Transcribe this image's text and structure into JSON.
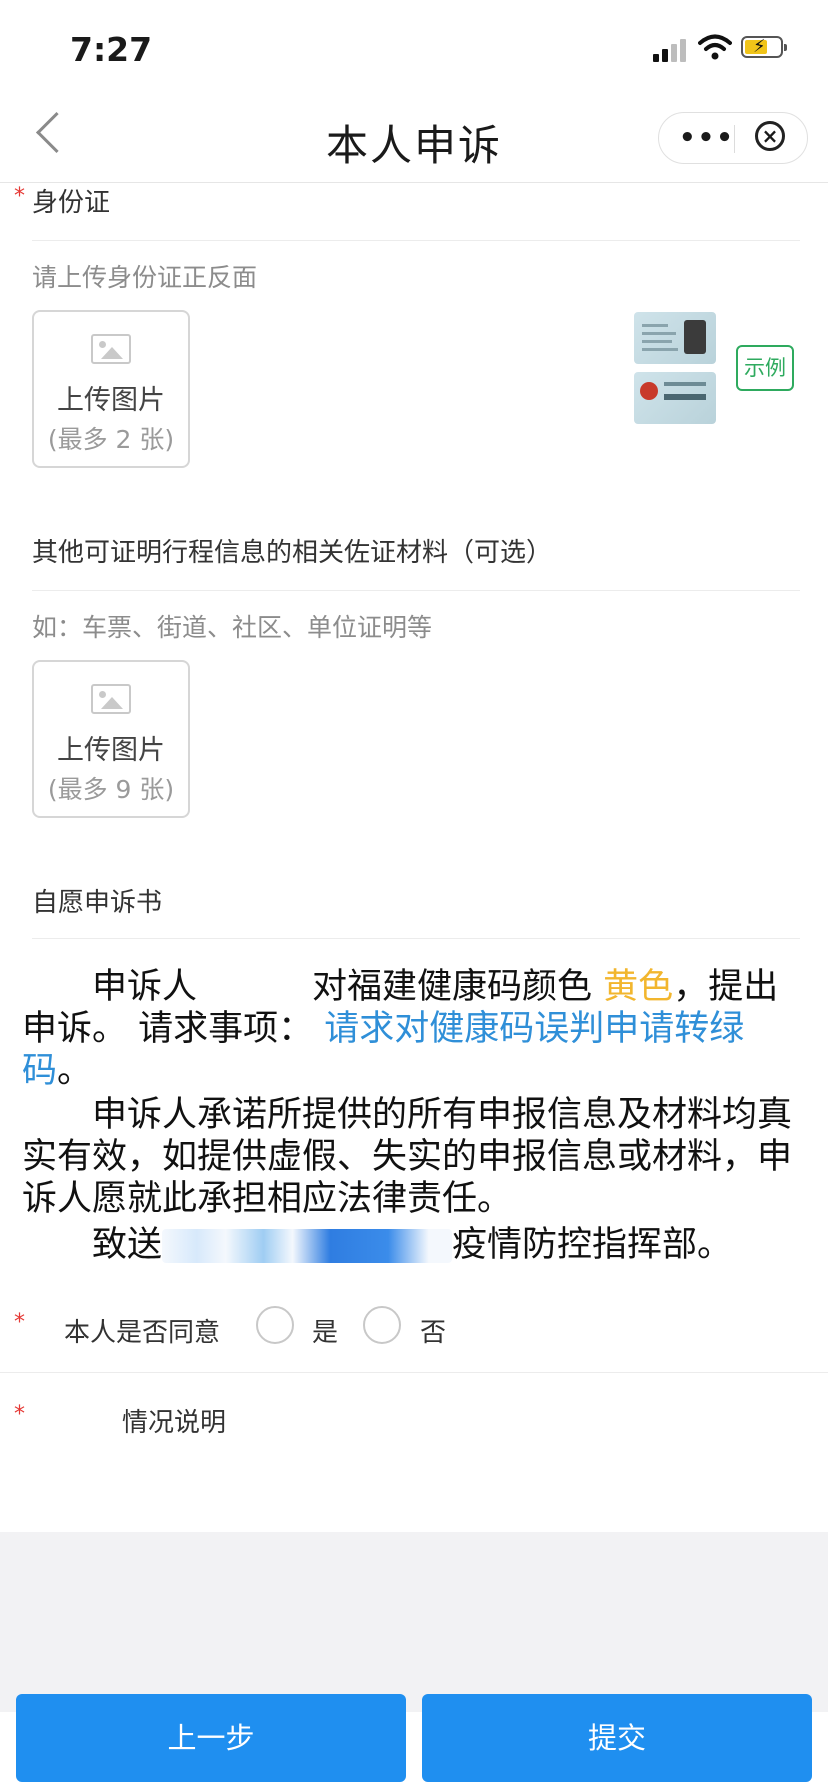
{
  "status_bar": {
    "time": "7:27"
  },
  "nav": {
    "title": "本人申诉",
    "more_icon": "more-dots-icon",
    "close_icon": "close-circle-icon"
  },
  "id_section": {
    "required_mark": "*",
    "label": "身份证",
    "hint": "请上传身份证正反面",
    "upload": {
      "label": "上传图片",
      "limit": "(最多 2 张)"
    },
    "example_label": "示例"
  },
  "evidence_section": {
    "label": "其他可证明行程信息的相关佐证材料（可选）",
    "hint": "如：车票、街道、社区、单位证明等",
    "upload": {
      "label": "上传图片",
      "limit": "(最多 9 张)"
    }
  },
  "statement_section": {
    "label": "自愿申诉书",
    "p1_prefix": "申诉人",
    "p1_middle": "对福建健康码颜色",
    "p1_color": "黄色",
    "p1_suffix": "，提出申诉。 请求事项：",
    "p1_request": "请求对健康码误判申请转绿码",
    "p1_end": "。",
    "p2": "申诉人承诺所提供的所有申报信息及材料均真实有效，如提供虚假、失实的申报信息或材料，申诉人愿就此承担相应法律责任。",
    "p3_prefix": "致送",
    "p3_suffix": "疫情防控指挥部。"
  },
  "consent": {
    "required_mark": "*",
    "label": "本人是否同意",
    "options": [
      "是",
      "否"
    ]
  },
  "explanation": {
    "required_mark": "*",
    "label": "情况说明"
  },
  "footer": {
    "prev_label": "上一步",
    "submit_label": "提交"
  },
  "colors": {
    "accent": "#1f8ff0",
    "yellow_text": "#f2b62e",
    "link_blue": "#2f8fd8",
    "required": "#e53935",
    "example_green": "#2eaa5e"
  }
}
